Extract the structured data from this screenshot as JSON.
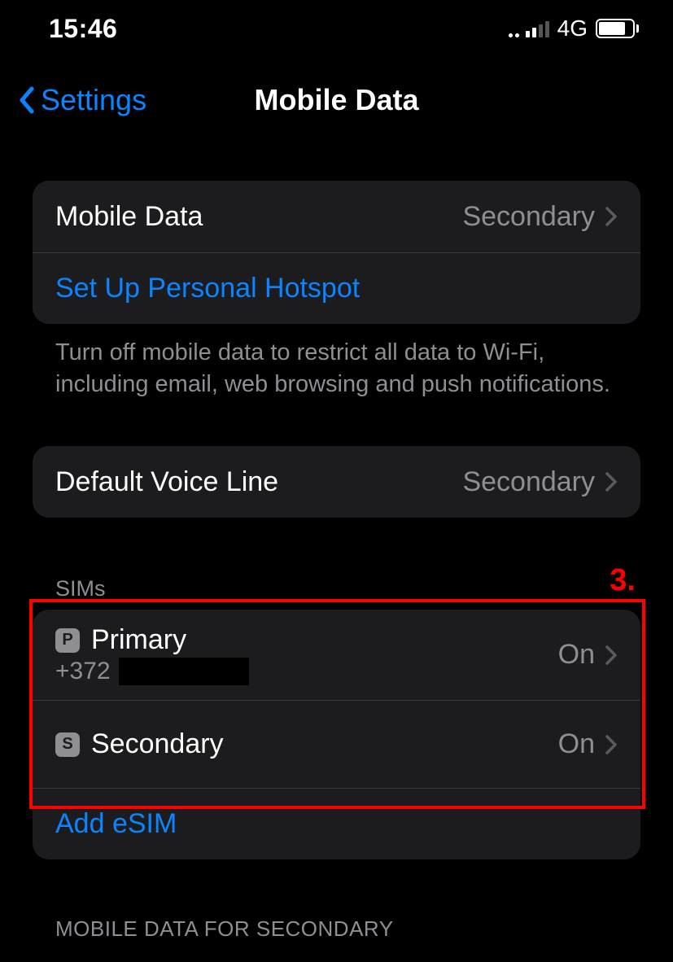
{
  "status": {
    "time": "15:46",
    "network_label": "4G"
  },
  "nav": {
    "back_label": "Settings",
    "title": "Mobile Data"
  },
  "group1": {
    "mobile_data_label": "Mobile Data",
    "mobile_data_value": "Secondary",
    "hotspot_label": "Set Up Personal Hotspot",
    "footer": "Turn off mobile data to restrict all data to Wi-Fi, including email, web browsing and push notifications."
  },
  "voice": {
    "label": "Default Voice Line",
    "value": "Secondary"
  },
  "sims": {
    "header": "SIMs",
    "items": [
      {
        "badge": "P",
        "name": "Primary",
        "sub_prefix": "+372",
        "status": "On"
      },
      {
        "badge": "S",
        "name": "Secondary",
        "sub_prefix": "",
        "status": "On"
      }
    ],
    "add_label": "Add eSIM"
  },
  "bottom_header": "MOBILE DATA FOR SECONDARY",
  "annotation": {
    "number": "3."
  }
}
